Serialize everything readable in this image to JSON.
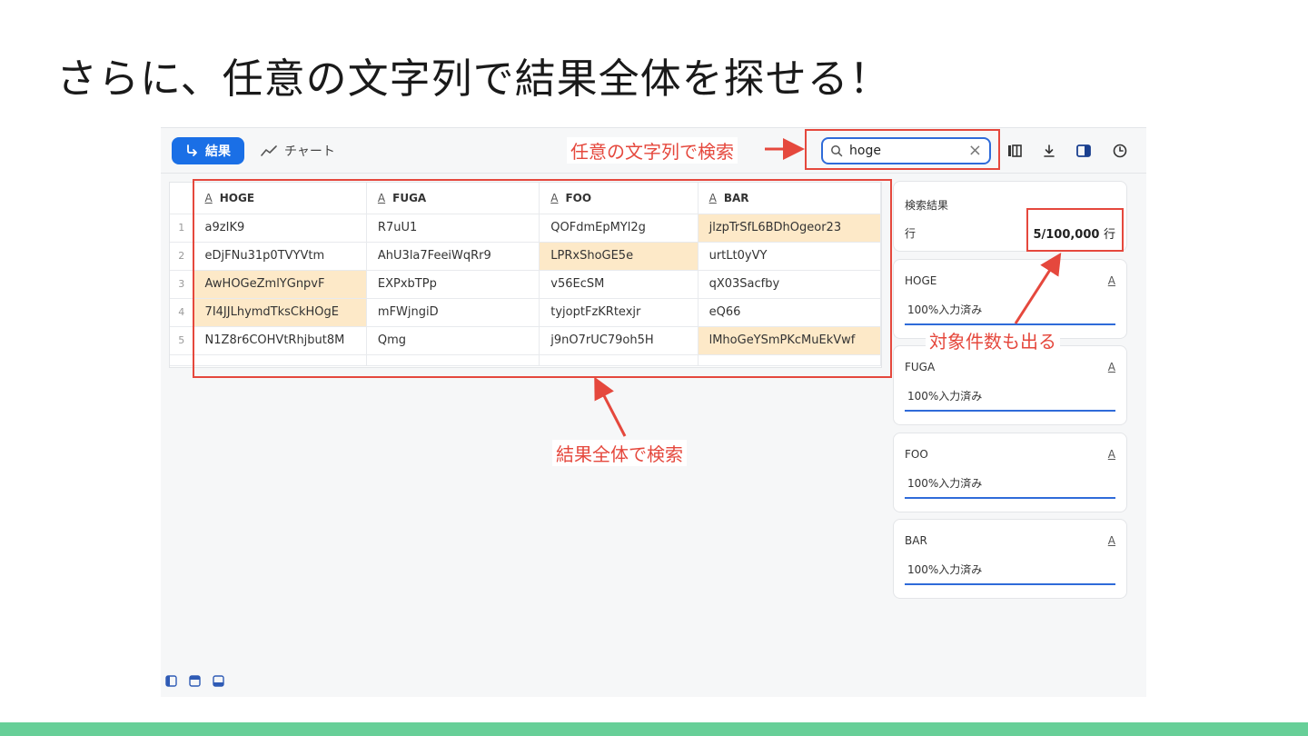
{
  "slide_title": "さらに、任意の文字列で結果全体を探せる！",
  "toolbar": {
    "results_label": "結果",
    "chart_label": "チャート",
    "search": {
      "value": "hoge",
      "clear_icon": "close-icon"
    },
    "icons": [
      "columns-icon",
      "download-icon",
      "panel-toggle-icon",
      "history-icon"
    ]
  },
  "table": {
    "columns": [
      "HOGE",
      "FUGA",
      "FOO",
      "BAR"
    ],
    "type_glyph": "A",
    "rows": [
      {
        "num": "1",
        "cells": [
          "a9zIK9",
          "R7uU1",
          "QOFdmEpMYl2g",
          "jlzpTrSfL6BDhOgeor23"
        ],
        "highlight": [
          false,
          false,
          false,
          true
        ]
      },
      {
        "num": "2",
        "cells": [
          "eDjFNu31p0TVYVtm",
          "AhU3la7FeeiWqRr9",
          "LPRxShoGE5e",
          "urtLt0yVY"
        ],
        "highlight": [
          false,
          false,
          true,
          false
        ]
      },
      {
        "num": "3",
        "cells": [
          "AwHOGeZmlYGnpvF",
          "EXPxbTPp",
          "v56EcSM",
          "qX03Sacfby"
        ],
        "highlight": [
          true,
          false,
          false,
          false
        ]
      },
      {
        "num": "4",
        "cells": [
          "7I4JJLhymdTksCkHOgE",
          "mFWjngiD",
          "tyjoptFzKRtexjr",
          "eQ66"
        ],
        "highlight": [
          true,
          false,
          false,
          false
        ]
      },
      {
        "num": "5",
        "cells": [
          "N1Z8r6COHVtRhjbut8M",
          "Qmg",
          "j9nO7rUC79oh5H",
          "lMhoGeYSmPKcMuEkVwf"
        ],
        "highlight": [
          false,
          false,
          false,
          true
        ]
      }
    ],
    "highlight_color": "#fde9c8"
  },
  "side_panel": {
    "summary": {
      "title": "検索結果",
      "row_label": "行",
      "count": "5/100,000",
      "count_unit": "行"
    },
    "columns": [
      {
        "name": "HOGE",
        "glyph": "A",
        "value": "100%入力済み"
      },
      {
        "name": "FUGA",
        "glyph": "A",
        "value": "100%入力済み"
      },
      {
        "name": "FOO",
        "glyph": "A",
        "value": "100%入力済み"
      },
      {
        "name": "BAR",
        "glyph": "A",
        "value": "100%入力済み"
      }
    ]
  },
  "annotations": {
    "search_note": "任意の文字列で検索",
    "table_note": "結果全体で検索",
    "count_note": "対象件数も出る",
    "color": "#e5483d"
  },
  "colors": {
    "accent": "#1a6fe6",
    "footer": "#67cf98"
  }
}
